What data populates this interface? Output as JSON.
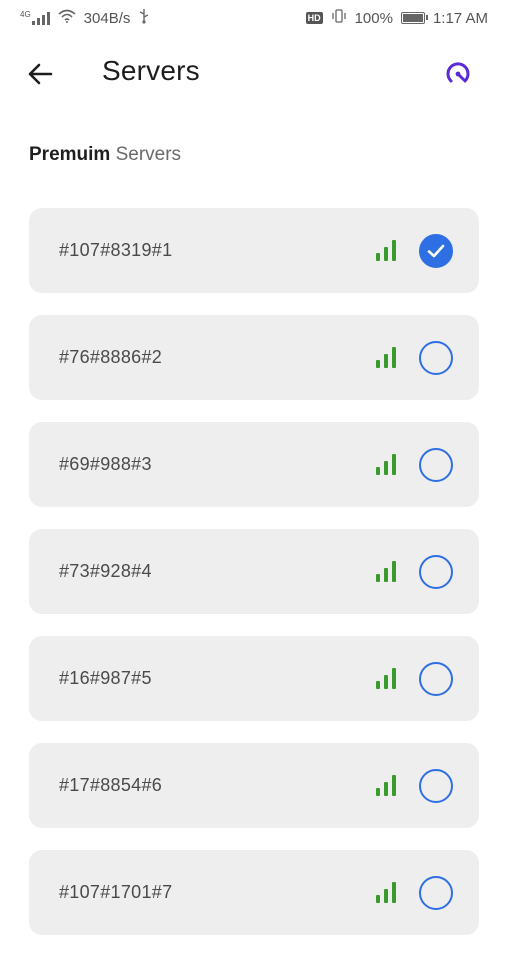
{
  "status_bar": {
    "network_type": "4G",
    "speed": "304B/s",
    "battery": "100%",
    "time": "1:17 AM",
    "hd": "HD"
  },
  "app_bar": {
    "title": "Servers",
    "back_icon": "arrow-left-icon",
    "action_icon": "speedometer-icon",
    "action_color": "#5b2bd6"
  },
  "section": {
    "title_bold": "Premuim",
    "title_light": "Servers"
  },
  "colors": {
    "row_bg": "#eeeeee",
    "signal": "#3a9a2e",
    "radio": "#2f6fe4"
  },
  "servers": [
    {
      "name": "#107#8319#1",
      "selected": true
    },
    {
      "name": "#76#8886#2",
      "selected": false
    },
    {
      "name": "#69#988#3",
      "selected": false
    },
    {
      "name": "#73#928#4",
      "selected": false
    },
    {
      "name": "#16#987#5",
      "selected": false
    },
    {
      "name": "#17#8854#6",
      "selected": false
    },
    {
      "name": "#107#1701#7",
      "selected": false
    }
  ]
}
